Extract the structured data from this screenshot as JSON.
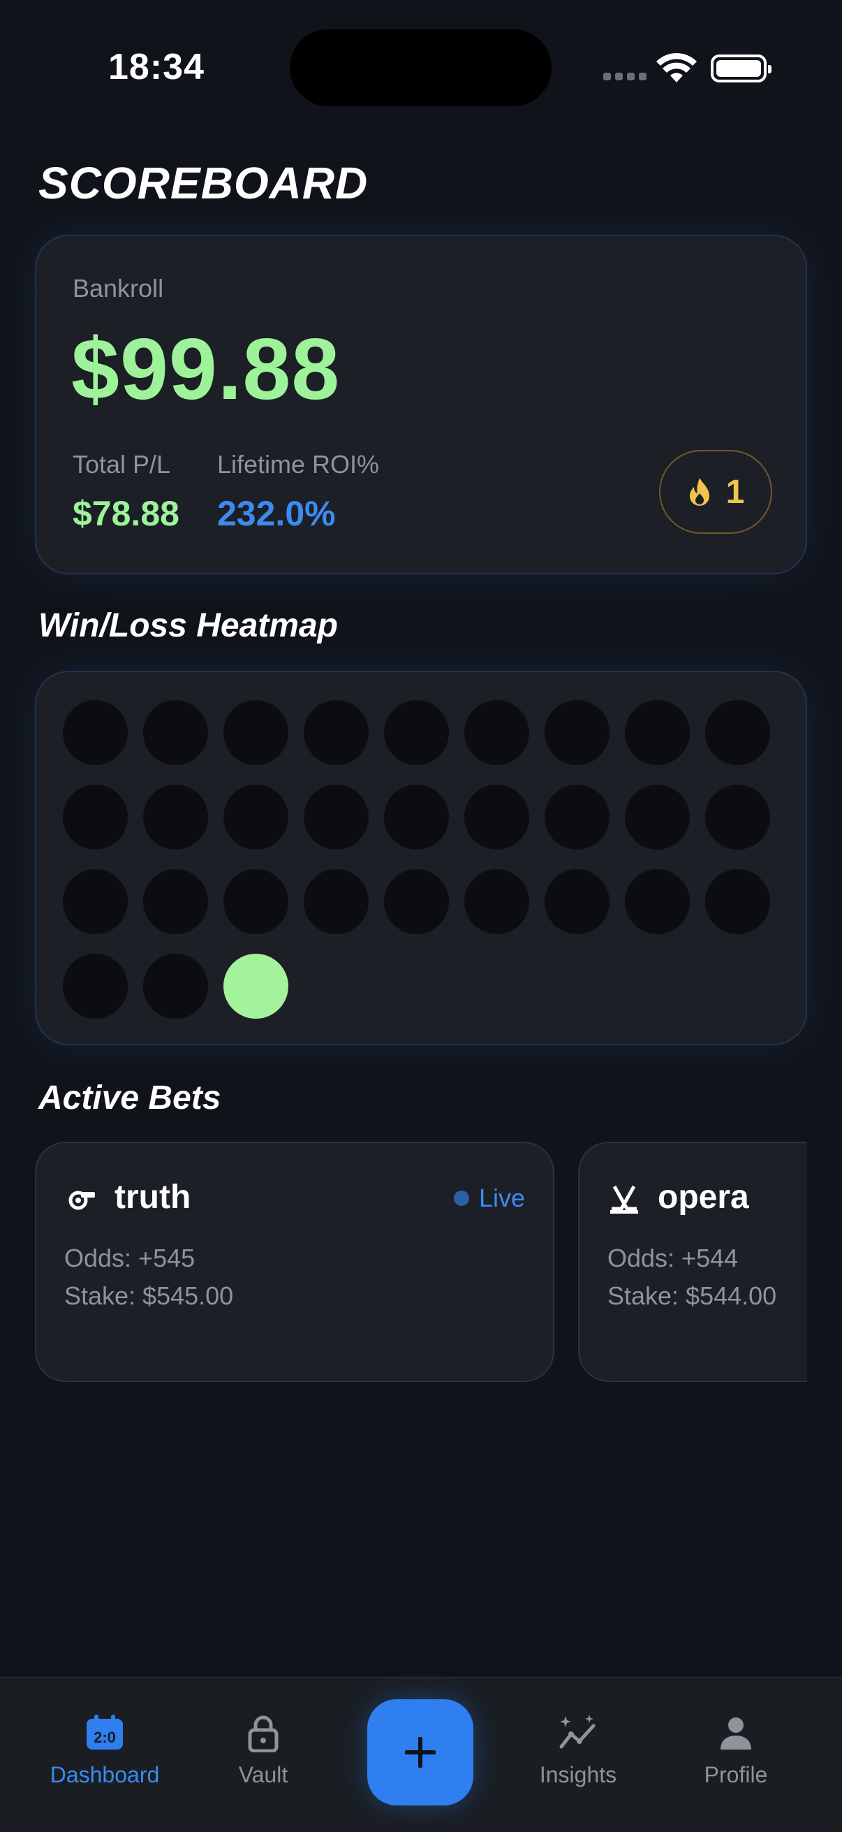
{
  "status_bar": {
    "time": "18:34"
  },
  "header": {
    "title": "SCOREBOARD"
  },
  "bankroll": {
    "label": "Bankroll",
    "amount": "$99.88",
    "total_pl_label": "Total P/L",
    "total_pl_value": "$78.88",
    "roi_label": "Lifetime ROI%",
    "roi_value": "232.0%",
    "streak_icon": "fire-icon",
    "streak_count": "1"
  },
  "heatmap": {
    "title": "Win/Loss Heatmap",
    "cells": [
      "none",
      "none",
      "none",
      "none",
      "none",
      "none",
      "none",
      "none",
      "none",
      "none",
      "none",
      "none",
      "none",
      "none",
      "none",
      "none",
      "none",
      "none",
      "none",
      "none",
      "none",
      "none",
      "none",
      "none",
      "none",
      "none",
      "none",
      "none",
      "none",
      "win"
    ]
  },
  "active_bets": {
    "title": "Active Bets",
    "bets": [
      {
        "icon": "whistle-icon",
        "name": "truth",
        "status": "Live",
        "odds": "Odds: +545",
        "stake": "Stake: $545.00"
      },
      {
        "icon": "hockey-sticks-icon",
        "name": "opera",
        "odds": "Odds: +544",
        "stake": "Stake: $544.00"
      }
    ]
  },
  "nav": {
    "items": [
      {
        "label": "Dashboard",
        "icon": "calendar-scoreboard-icon",
        "active": true
      },
      {
        "label": "Vault",
        "icon": "lock-icon"
      },
      {
        "label": "Insights",
        "icon": "trend-sparkle-icon"
      },
      {
        "label": "Profile",
        "icon": "person-icon"
      }
    ],
    "fab_icon": "plus-icon"
  },
  "colors": {
    "accent": "#2f7ff0",
    "win": "#a5f29c",
    "roi": "#3b8bf0",
    "streak": "#f0c34c"
  }
}
